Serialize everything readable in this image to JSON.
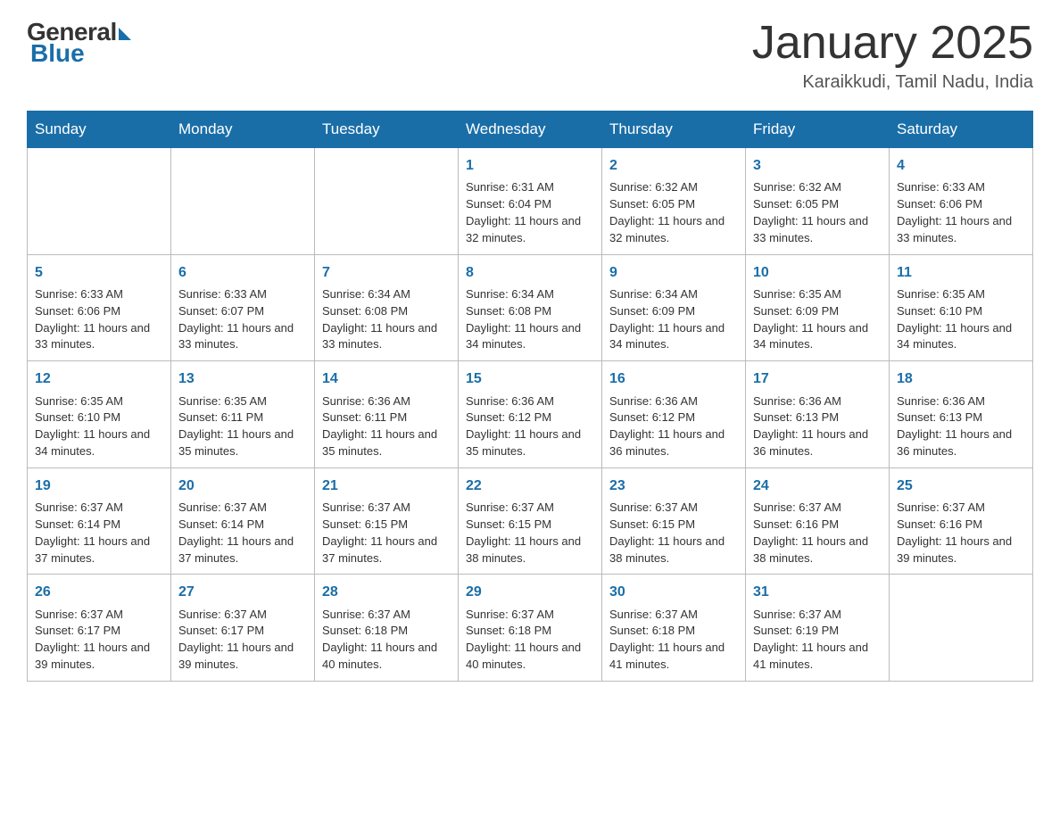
{
  "header": {
    "logo_general": "General",
    "logo_blue": "Blue",
    "month_title": "January 2025",
    "location": "Karaikkudi, Tamil Nadu, India"
  },
  "days_of_week": [
    "Sunday",
    "Monday",
    "Tuesday",
    "Wednesday",
    "Thursday",
    "Friday",
    "Saturday"
  ],
  "weeks": [
    [
      {
        "day": "",
        "info": ""
      },
      {
        "day": "",
        "info": ""
      },
      {
        "day": "",
        "info": ""
      },
      {
        "day": "1",
        "info": "Sunrise: 6:31 AM\nSunset: 6:04 PM\nDaylight: 11 hours and 32 minutes."
      },
      {
        "day": "2",
        "info": "Sunrise: 6:32 AM\nSunset: 6:05 PM\nDaylight: 11 hours and 32 minutes."
      },
      {
        "day": "3",
        "info": "Sunrise: 6:32 AM\nSunset: 6:05 PM\nDaylight: 11 hours and 33 minutes."
      },
      {
        "day": "4",
        "info": "Sunrise: 6:33 AM\nSunset: 6:06 PM\nDaylight: 11 hours and 33 minutes."
      }
    ],
    [
      {
        "day": "5",
        "info": "Sunrise: 6:33 AM\nSunset: 6:06 PM\nDaylight: 11 hours and 33 minutes."
      },
      {
        "day": "6",
        "info": "Sunrise: 6:33 AM\nSunset: 6:07 PM\nDaylight: 11 hours and 33 minutes."
      },
      {
        "day": "7",
        "info": "Sunrise: 6:34 AM\nSunset: 6:08 PM\nDaylight: 11 hours and 33 minutes."
      },
      {
        "day": "8",
        "info": "Sunrise: 6:34 AM\nSunset: 6:08 PM\nDaylight: 11 hours and 34 minutes."
      },
      {
        "day": "9",
        "info": "Sunrise: 6:34 AM\nSunset: 6:09 PM\nDaylight: 11 hours and 34 minutes."
      },
      {
        "day": "10",
        "info": "Sunrise: 6:35 AM\nSunset: 6:09 PM\nDaylight: 11 hours and 34 minutes."
      },
      {
        "day": "11",
        "info": "Sunrise: 6:35 AM\nSunset: 6:10 PM\nDaylight: 11 hours and 34 minutes."
      }
    ],
    [
      {
        "day": "12",
        "info": "Sunrise: 6:35 AM\nSunset: 6:10 PM\nDaylight: 11 hours and 34 minutes."
      },
      {
        "day": "13",
        "info": "Sunrise: 6:35 AM\nSunset: 6:11 PM\nDaylight: 11 hours and 35 minutes."
      },
      {
        "day": "14",
        "info": "Sunrise: 6:36 AM\nSunset: 6:11 PM\nDaylight: 11 hours and 35 minutes."
      },
      {
        "day": "15",
        "info": "Sunrise: 6:36 AM\nSunset: 6:12 PM\nDaylight: 11 hours and 35 minutes."
      },
      {
        "day": "16",
        "info": "Sunrise: 6:36 AM\nSunset: 6:12 PM\nDaylight: 11 hours and 36 minutes."
      },
      {
        "day": "17",
        "info": "Sunrise: 6:36 AM\nSunset: 6:13 PM\nDaylight: 11 hours and 36 minutes."
      },
      {
        "day": "18",
        "info": "Sunrise: 6:36 AM\nSunset: 6:13 PM\nDaylight: 11 hours and 36 minutes."
      }
    ],
    [
      {
        "day": "19",
        "info": "Sunrise: 6:37 AM\nSunset: 6:14 PM\nDaylight: 11 hours and 37 minutes."
      },
      {
        "day": "20",
        "info": "Sunrise: 6:37 AM\nSunset: 6:14 PM\nDaylight: 11 hours and 37 minutes."
      },
      {
        "day": "21",
        "info": "Sunrise: 6:37 AM\nSunset: 6:15 PM\nDaylight: 11 hours and 37 minutes."
      },
      {
        "day": "22",
        "info": "Sunrise: 6:37 AM\nSunset: 6:15 PM\nDaylight: 11 hours and 38 minutes."
      },
      {
        "day": "23",
        "info": "Sunrise: 6:37 AM\nSunset: 6:15 PM\nDaylight: 11 hours and 38 minutes."
      },
      {
        "day": "24",
        "info": "Sunrise: 6:37 AM\nSunset: 6:16 PM\nDaylight: 11 hours and 38 minutes."
      },
      {
        "day": "25",
        "info": "Sunrise: 6:37 AM\nSunset: 6:16 PM\nDaylight: 11 hours and 39 minutes."
      }
    ],
    [
      {
        "day": "26",
        "info": "Sunrise: 6:37 AM\nSunset: 6:17 PM\nDaylight: 11 hours and 39 minutes."
      },
      {
        "day": "27",
        "info": "Sunrise: 6:37 AM\nSunset: 6:17 PM\nDaylight: 11 hours and 39 minutes."
      },
      {
        "day": "28",
        "info": "Sunrise: 6:37 AM\nSunset: 6:18 PM\nDaylight: 11 hours and 40 minutes."
      },
      {
        "day": "29",
        "info": "Sunrise: 6:37 AM\nSunset: 6:18 PM\nDaylight: 11 hours and 40 minutes."
      },
      {
        "day": "30",
        "info": "Sunrise: 6:37 AM\nSunset: 6:18 PM\nDaylight: 11 hours and 41 minutes."
      },
      {
        "day": "31",
        "info": "Sunrise: 6:37 AM\nSunset: 6:19 PM\nDaylight: 11 hours and 41 minutes."
      },
      {
        "day": "",
        "info": ""
      }
    ]
  ]
}
